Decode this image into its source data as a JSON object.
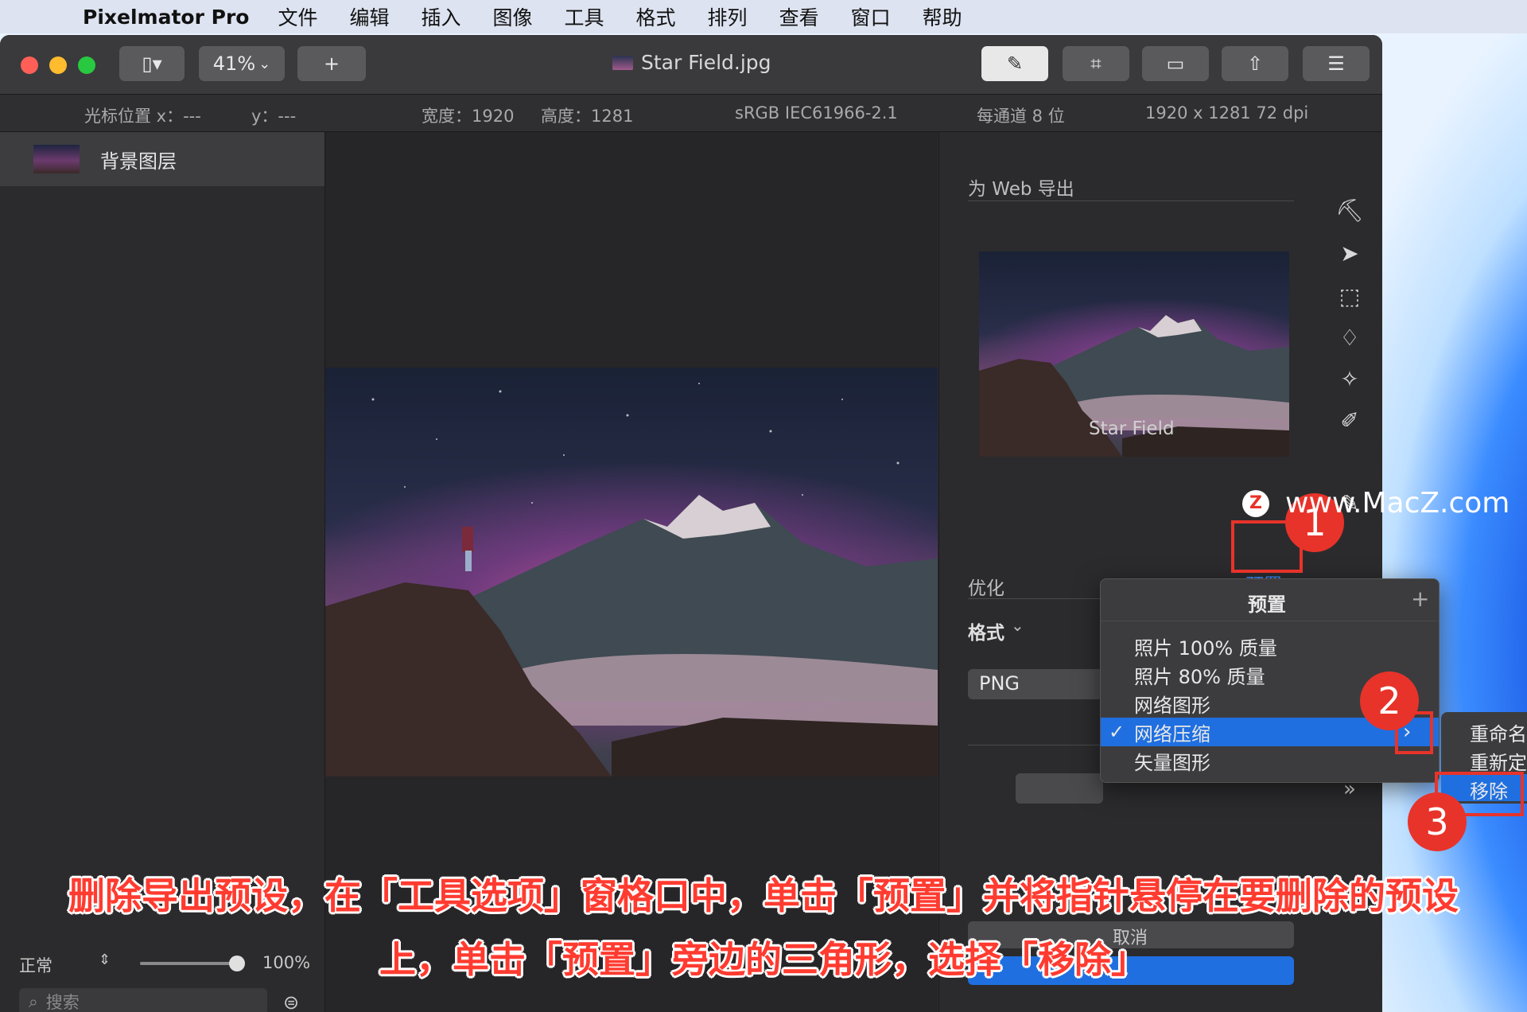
{
  "menubar": {
    "app_name": "Pixelmator Pro",
    "items": [
      "文件",
      "编辑",
      "插入",
      "图像",
      "工具",
      "格式",
      "排列",
      "查看",
      "窗口",
      "帮助"
    ]
  },
  "titlebar": {
    "zoom": "41%",
    "add_label": "+",
    "doc_title": "Star Field.jpg"
  },
  "infobar": {
    "cursor_x": "光标位置 x：---",
    "cursor_y": "y：---",
    "width": "宽度：1920",
    "height": "高度：1281",
    "colorspace": "sRGB IEC61966-2.1",
    "depth": "每通道 8 位",
    "resolution": "1920 x 1281 72 dpi"
  },
  "layers": {
    "items": [
      {
        "name": "背景图层"
      }
    ],
    "blend_mode": "正常",
    "opacity": "100%",
    "search_placeholder": "搜索"
  },
  "export_panel": {
    "title": "为 Web 导出",
    "preview_name": "Star Field",
    "optimize_label": "优化",
    "presets_button": "预置",
    "format_label": "格式",
    "format_value": "PNG",
    "cancel_label": "取消",
    "next_label": "..."
  },
  "preset_menu": {
    "title": "预置",
    "add_label": "+",
    "items": [
      {
        "label": "照片 100% 质量",
        "checked": false
      },
      {
        "label": "照片 80% 质量",
        "checked": false
      },
      {
        "label": "网络图形",
        "checked": false
      },
      {
        "label": "网络压缩",
        "checked": true
      },
      {
        "label": "矢量图形",
        "checked": false
      }
    ],
    "submenu": [
      "重命名",
      "重新定",
      "移除"
    ]
  },
  "callouts": [
    "1",
    "2",
    "3"
  ],
  "watermark": "www.MacZ.com",
  "caption": {
    "line1": "删除导出预设，在「工具选项」窗格口中，单击「预置」并将指针悬停在要删除的预设",
    "line2": "上，单击「预置」旁边的三角形，选择「移除」"
  },
  "colors": {
    "accent": "#1f6fe0",
    "callout": "#e8332a",
    "window_bg": "#2b2b2d"
  }
}
